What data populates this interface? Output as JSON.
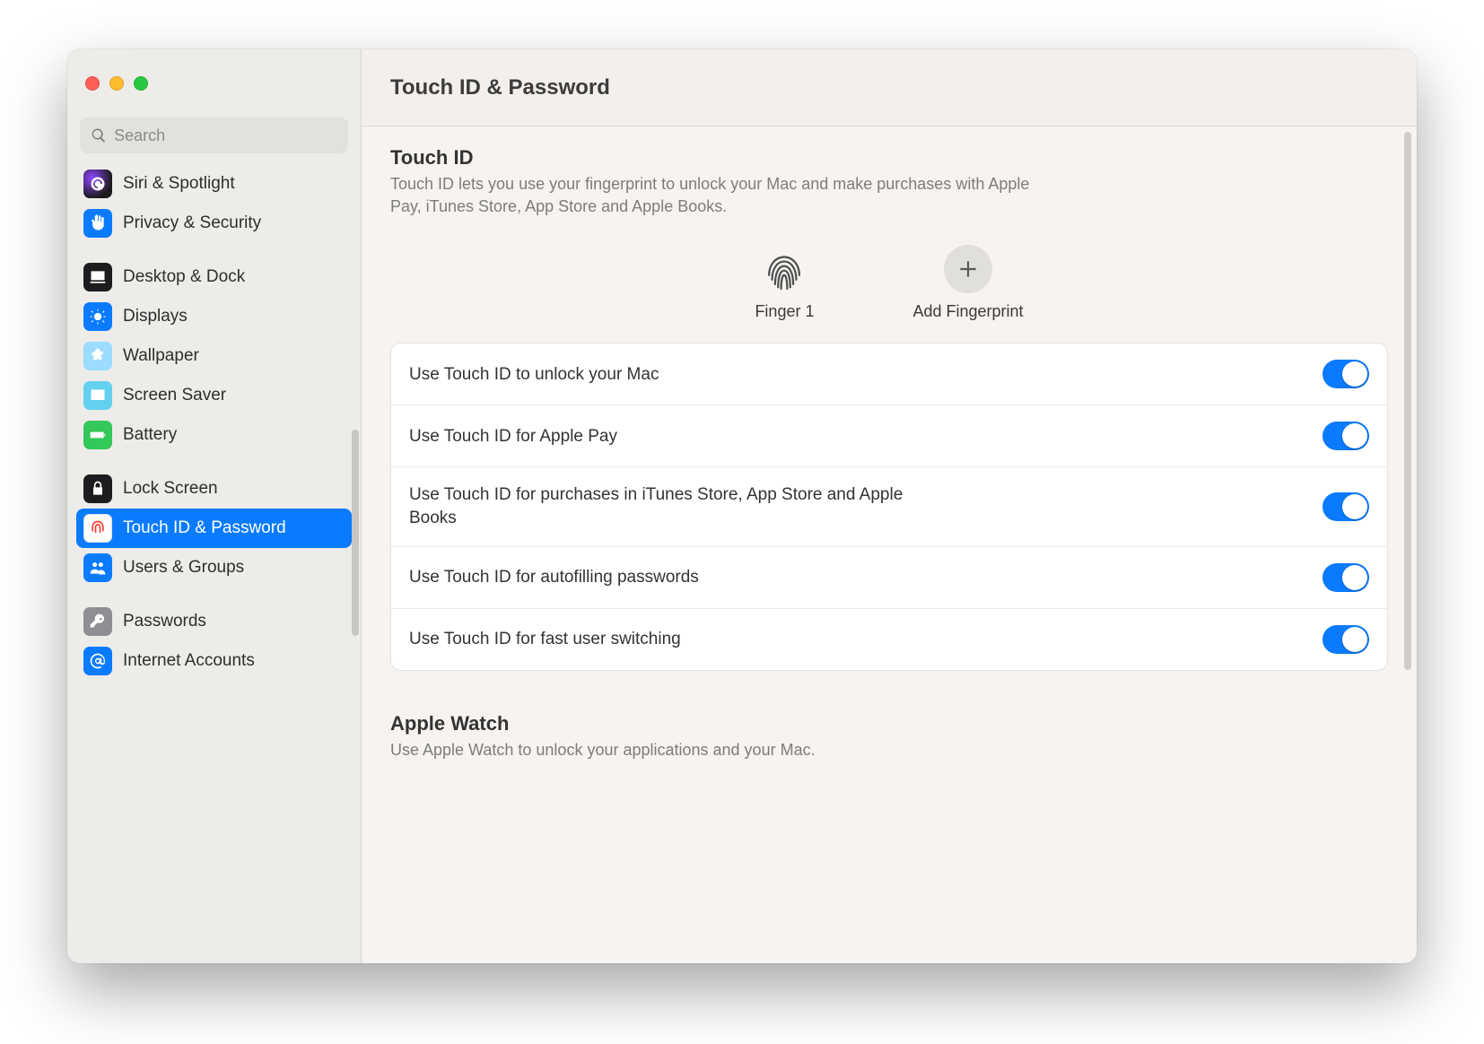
{
  "header": {
    "title": "Touch ID & Password"
  },
  "search": {
    "placeholder": "Search"
  },
  "sidebar": {
    "groups": [
      {
        "items": [
          {
            "label": "Siri & Spotlight",
            "icon": "siri",
            "bg": "bg-siri"
          },
          {
            "label": "Privacy & Security",
            "icon": "hand",
            "bg": "bg-blue"
          }
        ]
      },
      {
        "items": [
          {
            "label": "Desktop & Dock",
            "icon": "dock",
            "bg": "bg-black"
          },
          {
            "label": "Displays",
            "icon": "sun",
            "bg": "bg-blue"
          },
          {
            "label": "Wallpaper",
            "icon": "flower",
            "bg": "bg-flower"
          },
          {
            "label": "Screen Saver",
            "icon": "screensaver",
            "bg": "bg-cyan"
          },
          {
            "label": "Battery",
            "icon": "battery",
            "bg": "bg-green"
          }
        ]
      },
      {
        "items": [
          {
            "label": "Lock Screen",
            "icon": "lock",
            "bg": "bg-black"
          },
          {
            "label": "Touch ID & Password",
            "icon": "fingerprint",
            "bg": "bg-white",
            "selected": true
          },
          {
            "label": "Users & Groups",
            "icon": "users",
            "bg": "bg-blue"
          }
        ]
      },
      {
        "items": [
          {
            "label": "Passwords",
            "icon": "key",
            "bg": "bg-grey"
          },
          {
            "label": "Internet Accounts",
            "icon": "at",
            "bg": "bg-blue"
          }
        ]
      }
    ]
  },
  "touchid": {
    "title": "Touch ID",
    "desc": "Touch ID lets you use your fingerprint to unlock your Mac and make purchases with Apple Pay, iTunes Store, App Store and Apple Books.",
    "finger_label": "Finger 1",
    "add_label": "Add Fingerprint",
    "options": [
      {
        "label": "Use Touch ID to unlock your Mac",
        "on": true
      },
      {
        "label": "Use Touch ID for Apple Pay",
        "on": true
      },
      {
        "label": "Use Touch ID for purchases in iTunes Store, App Store and Apple Books",
        "on": true
      },
      {
        "label": "Use Touch ID for autofilling passwords",
        "on": true
      },
      {
        "label": "Use Touch ID for fast user switching",
        "on": true
      }
    ]
  },
  "applewatch": {
    "title": "Apple Watch",
    "desc": "Use Apple Watch to unlock your applications and your Mac."
  }
}
